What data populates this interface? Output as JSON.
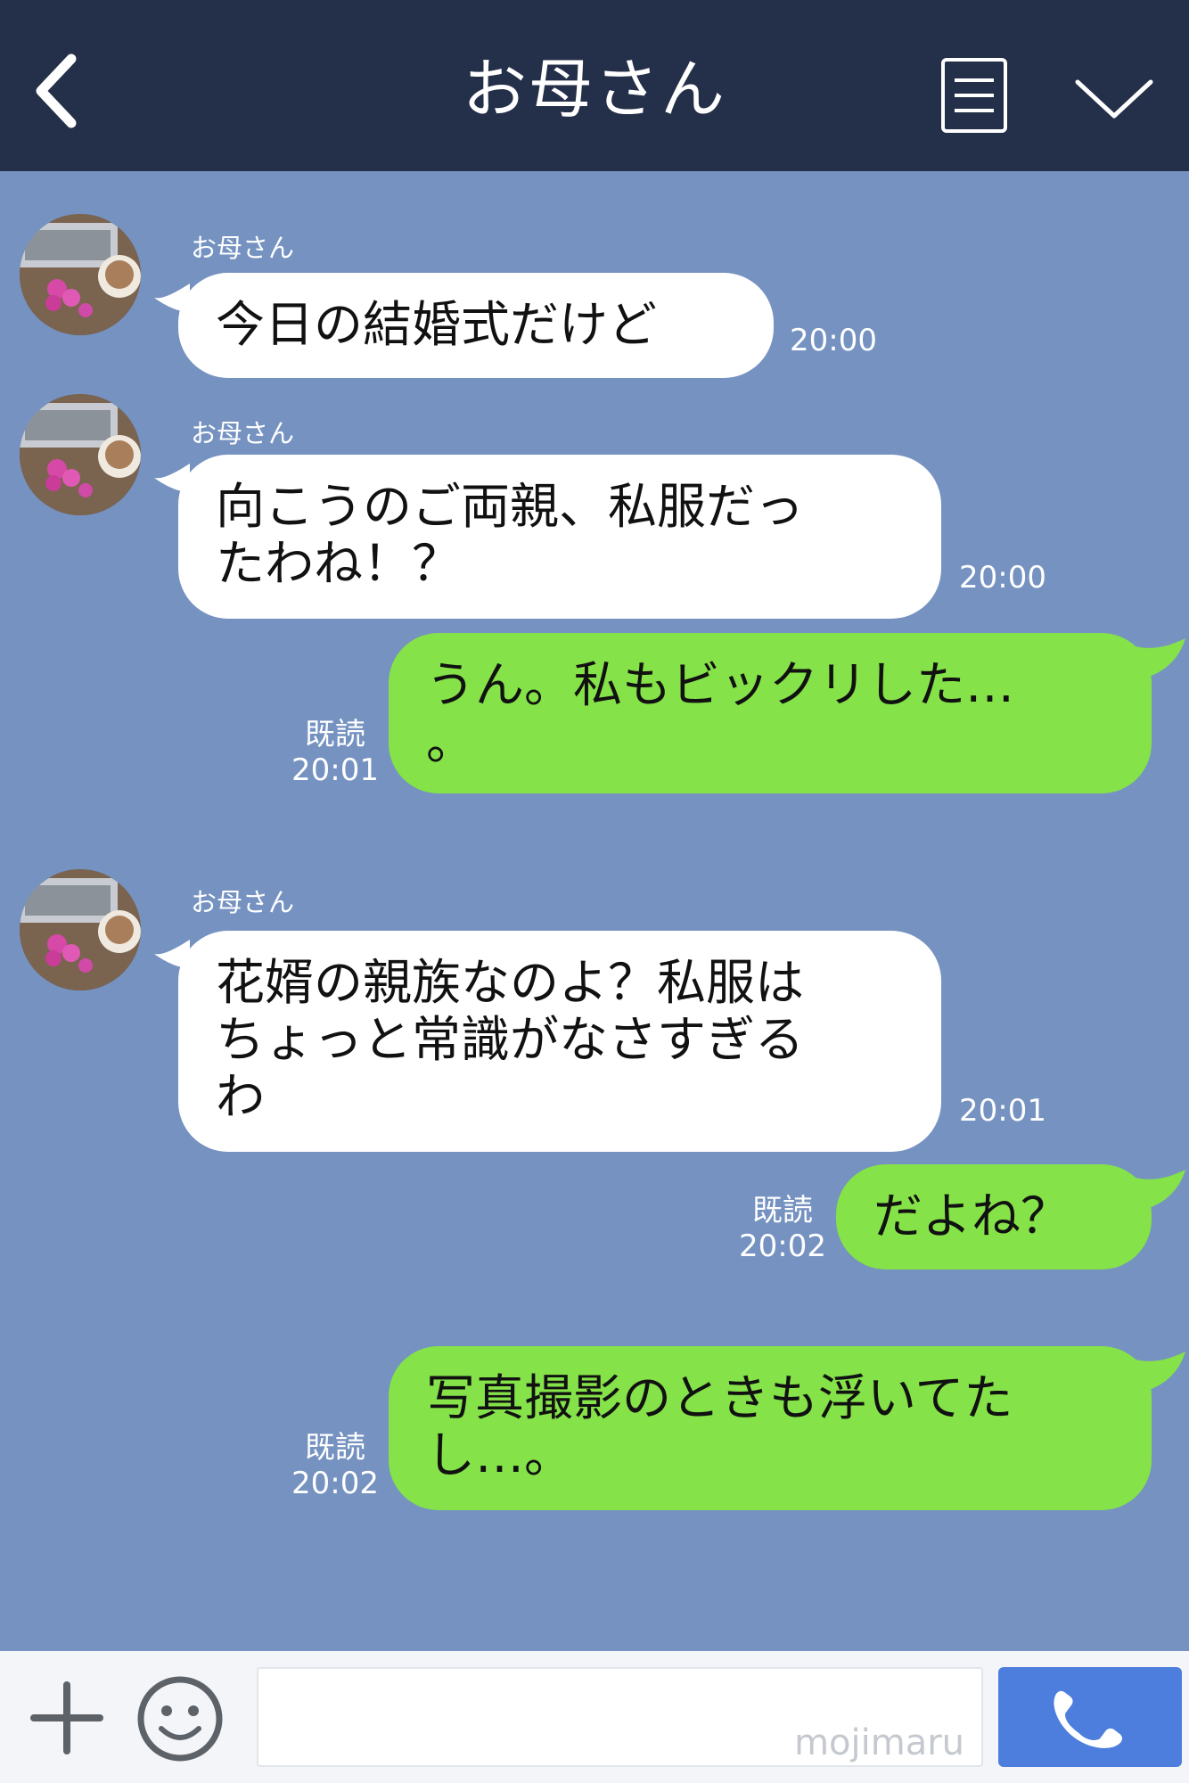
{
  "header": {
    "title": "お母さん",
    "icons": {
      "back": "chevron-left-icon",
      "menu": "menu-list-icon",
      "collapse": "chevron-down-icon"
    }
  },
  "colors": {
    "header_bg": "#243049",
    "chat_bg": "#7592c1",
    "incoming_bubble": "#ffffff",
    "outgoing_bubble": "#85e249",
    "call_button": "#4d7ede"
  },
  "messages": [
    {
      "sender": "お母さん",
      "text": "今日の結婚式だけど",
      "time": "20:00"
    },
    {
      "sender": "お母さん",
      "text": "向こうのご両親、私服だっ\nたわね！？",
      "time": "20:00"
    },
    {
      "text": "うん。私もビックリした…\n。",
      "read": "既読",
      "time": "20:01"
    },
    {
      "sender": "お母さん",
      "text": "花婿の親族なのよ？私服は\nちょっと常識がなさすぎる\nわ",
      "time": "20:01"
    },
    {
      "text": "だよね？",
      "read": "既読",
      "time": "20:02"
    },
    {
      "text": "写真撮影のときも浮いてた\nし…。",
      "read": "既読",
      "time": "20:02"
    }
  ],
  "footer": {
    "input_value": "",
    "watermark": "mojimaru",
    "icons": {
      "add": "plus-icon",
      "emoji": "smiley-icon",
      "call": "phone-icon"
    }
  }
}
